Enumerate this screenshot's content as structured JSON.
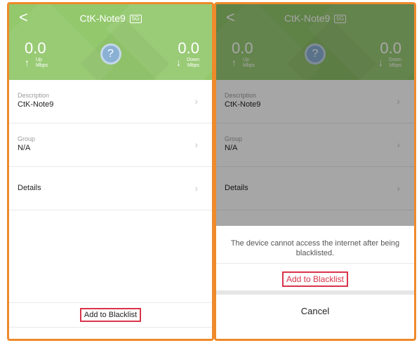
{
  "header": {
    "title": "CtK-Note9",
    "band": "5G",
    "back_glyph": "<"
  },
  "speed": {
    "up_value": "0.0",
    "up_label": "Up",
    "up_unit": "Mbps",
    "down_value": "0.0",
    "down_label": "Down",
    "down_unit": "Mbps",
    "status_glyph": "?"
  },
  "items": [
    {
      "label": "Description",
      "value": "CtK-Note9"
    },
    {
      "label": "Group",
      "value": "N/A"
    },
    {
      "label": "",
      "value": "Details"
    }
  ],
  "blacklist_button": "Add to Blacklist",
  "sheet": {
    "message": "The device cannot access the internet after being blacklisted.",
    "action": "Add to Blacklist",
    "cancel": "Cancel"
  },
  "colors": {
    "header_green": "#93c86d",
    "highlight_orange": "#ef8a2b",
    "accent_red": "#d9344a"
  }
}
